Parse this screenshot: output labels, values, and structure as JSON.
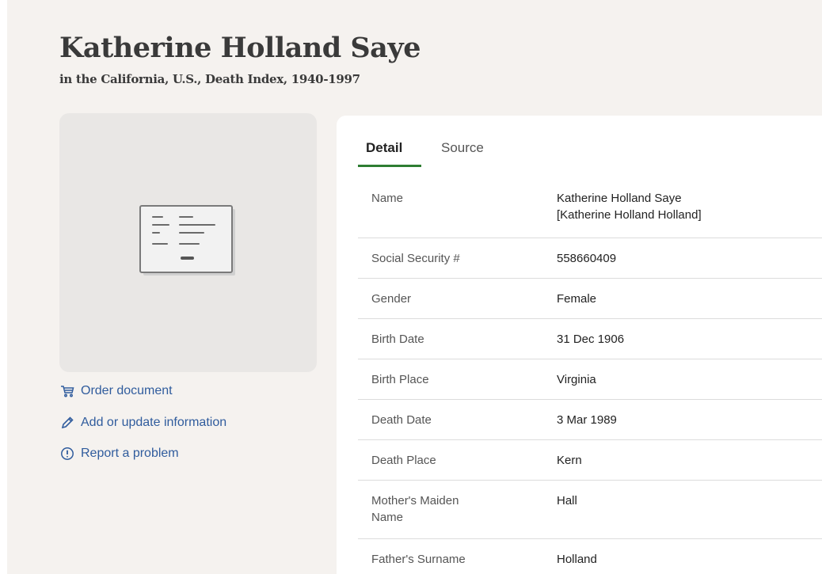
{
  "header": {
    "title": "Katherine Holland Saye",
    "subtitle": "in the California, U.S., Death Index, 1940-1997"
  },
  "document_card": {
    "icon": "document-icon"
  },
  "actions": [
    {
      "label": "Order document",
      "icon": "cart-icon"
    },
    {
      "label": "Add or update information",
      "icon": "pencil-icon"
    },
    {
      "label": "Report a problem",
      "icon": "alert-circle-icon"
    }
  ],
  "tabs": [
    {
      "label": "Detail",
      "active": true
    },
    {
      "label": "Source",
      "active": false
    }
  ],
  "details": [
    {
      "label": "Name",
      "value_line1": "Katherine Holland Saye",
      "value_line2": "[Katherine Holland Holland]"
    },
    {
      "label": "Social Security #",
      "value": "558660409"
    },
    {
      "label": "Gender",
      "value": "Female"
    },
    {
      "label": "Birth Date",
      "value": "31 Dec 1906"
    },
    {
      "label": "Birth Place",
      "value": "Virginia"
    },
    {
      "label": "Death Date",
      "value": "3 Mar 1989"
    },
    {
      "label": "Death Place",
      "value": "Kern"
    },
    {
      "label_line1": "Mother's Maiden",
      "label_line2": "Name",
      "value": "Hall"
    },
    {
      "label": "Father's Surname",
      "value": "Holland"
    }
  ],
  "colors": {
    "page_bg": "#f5f2ef",
    "link": "#305c9d",
    "tab_underline": "#2e7d32"
  }
}
